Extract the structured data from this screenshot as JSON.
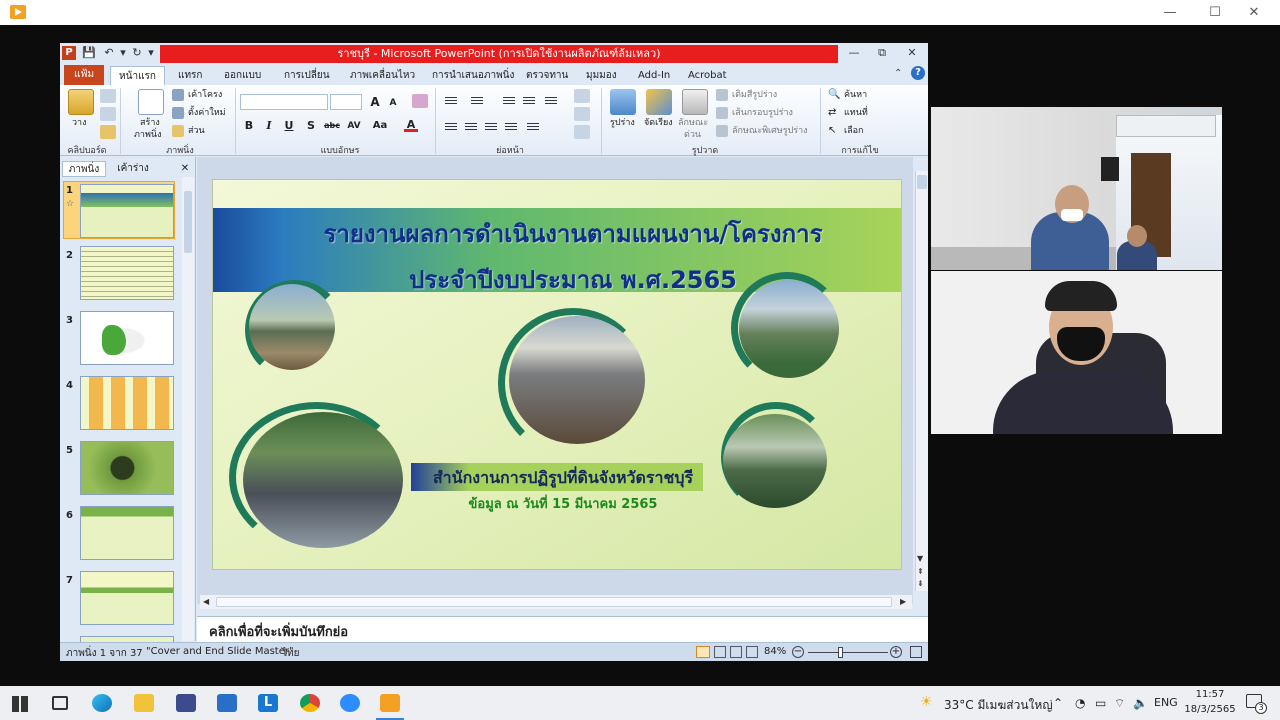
{
  "window": {
    "minimize": "—",
    "maximize": "☐",
    "close": "✕"
  },
  "powerpoint": {
    "title": "ราชบุรี - Microsoft PowerPoint (การเปิดใช้งานผลิตภัณฑ์ล้มเหลว)",
    "logo": "P",
    "qat": {
      "save": "💾",
      "undo": "↶",
      "undo_arrow": "▾",
      "redo": "↻",
      "customize": "▾"
    },
    "controls": {
      "minimize": "—",
      "restore": "⧉",
      "close": "✕"
    },
    "tabs": {
      "file": "แฟ้ม",
      "home": "หน้าแรก",
      "insert": "แทรก",
      "design": "ออกแบบ",
      "transitions": "การเปลี่ยน",
      "animations": "ภาพเคลื่อนไหว",
      "slideshow": "การนำเสนอภาพนิ่ง",
      "review": "ตรวจทาน",
      "view": "มุมมอง",
      "addin": "Add-In",
      "acrobat": "Acrobat"
    },
    "ribbon": {
      "clipboard": {
        "paste": "วาง",
        "label": "คลิปบอร์ด"
      },
      "slides": {
        "new_slide_1": "สร้าง",
        "new_slide_2": "ภาพนิ่ง",
        "layout": "เค้าโครง",
        "reset": "ตั้งค่าใหม่",
        "section": "ส่วน",
        "label": "ภาพนิ่ง"
      },
      "font": {
        "bold": "B",
        "italic": "I",
        "underline": "U",
        "shadow": "S",
        "strike": "abc",
        "spacing": "AV",
        "case": "Aa",
        "color": "A",
        "grow": "A",
        "shrink": "A",
        "label": "แบบอักษร"
      },
      "paragraph": {
        "label": "ย่อหน้า"
      },
      "drawing": {
        "shapes": "รูปร่าง",
        "arrange": "จัดเรียง",
        "quick_styles_1": "ลักษณะ",
        "quick_styles_2": "ด่วน",
        "fill": "เติมสีรูปร่าง",
        "outline": "เส้นกรอบรูปร่าง",
        "effects": "ลักษณะพิเศษรูปร่าง",
        "label": "รูปวาด"
      },
      "editing": {
        "find": "ค้นหา",
        "replace": "แทนที่",
        "select": "เลือก",
        "label": "การแก้ไข"
      }
    },
    "panel": {
      "tab_slides": "ภาพนิ่ง",
      "tab_outline": "เค้าร่าง",
      "close": "✕"
    },
    "thumbs": [
      {
        "num": "1"
      },
      {
        "num": "2"
      },
      {
        "num": "3"
      },
      {
        "num": "4"
      },
      {
        "num": "5"
      },
      {
        "num": "6"
      },
      {
        "num": "7"
      }
    ],
    "slide": {
      "title_line1": "รายงานผลการดำเนินงานตามแผนงาน/โครงการ",
      "title_line2": "ประจำปีงบประมาณ พ.ศ.2565",
      "org": "สำนักงานการปฏิรูปที่ดินจังหวัดราชบุรี",
      "date": "ข้อมูล ณ วันที่ 15 มีนาคม 2565"
    },
    "notes_placeholder": "คลิกเพื่อที่จะเพิ่มบันทึกย่อ",
    "status": {
      "slide_pos": "ภาพนิ่ง 1 จาก 37",
      "theme": "\"Cover and End Slide Master\"",
      "lang": "ไทย",
      "zoom": "84%"
    }
  },
  "taskbar": {
    "weather": "33°C มีเมฆส่วนใหญ่",
    "lang": "ENG",
    "time": "11:57",
    "date": "18/3/2565",
    "notif_count": "3"
  }
}
